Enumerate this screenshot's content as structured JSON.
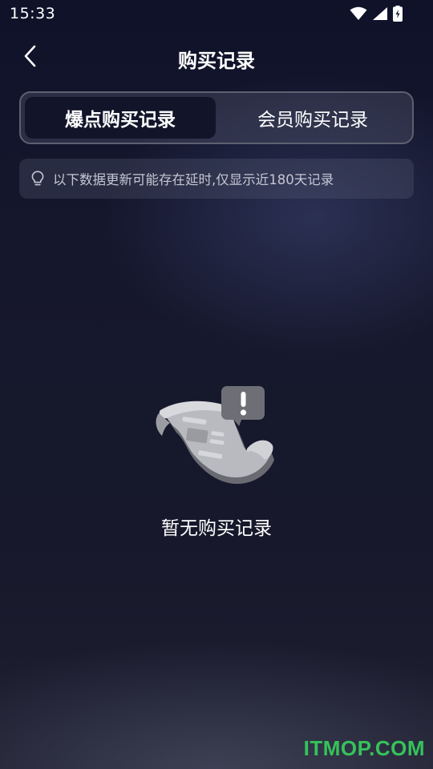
{
  "status_bar": {
    "time": "15:33",
    "icons": [
      "wifi-icon",
      "signal-icon",
      "battery-charging-icon"
    ]
  },
  "header": {
    "back_icon": "chevron-left-icon",
    "title": "购买记录"
  },
  "tabs": [
    {
      "label": "爆点购买记录",
      "active": true
    },
    {
      "label": "会员购买记录",
      "active": false
    }
  ],
  "notice": {
    "icon": "lightbulb-icon",
    "text": "以下数据更新可能存在延时,仅显示近180天记录"
  },
  "empty_state": {
    "illustration": "empty-receipt-illustration",
    "text": "暂无购买记录"
  },
  "watermark": {
    "text": "ITMOP.COM",
    "color": "#35c35a"
  },
  "colors": {
    "background": "#15172d",
    "tab_active_bg": "#12142a",
    "tab_border": "#5c6070",
    "notice_text": "#c4c6d2"
  }
}
